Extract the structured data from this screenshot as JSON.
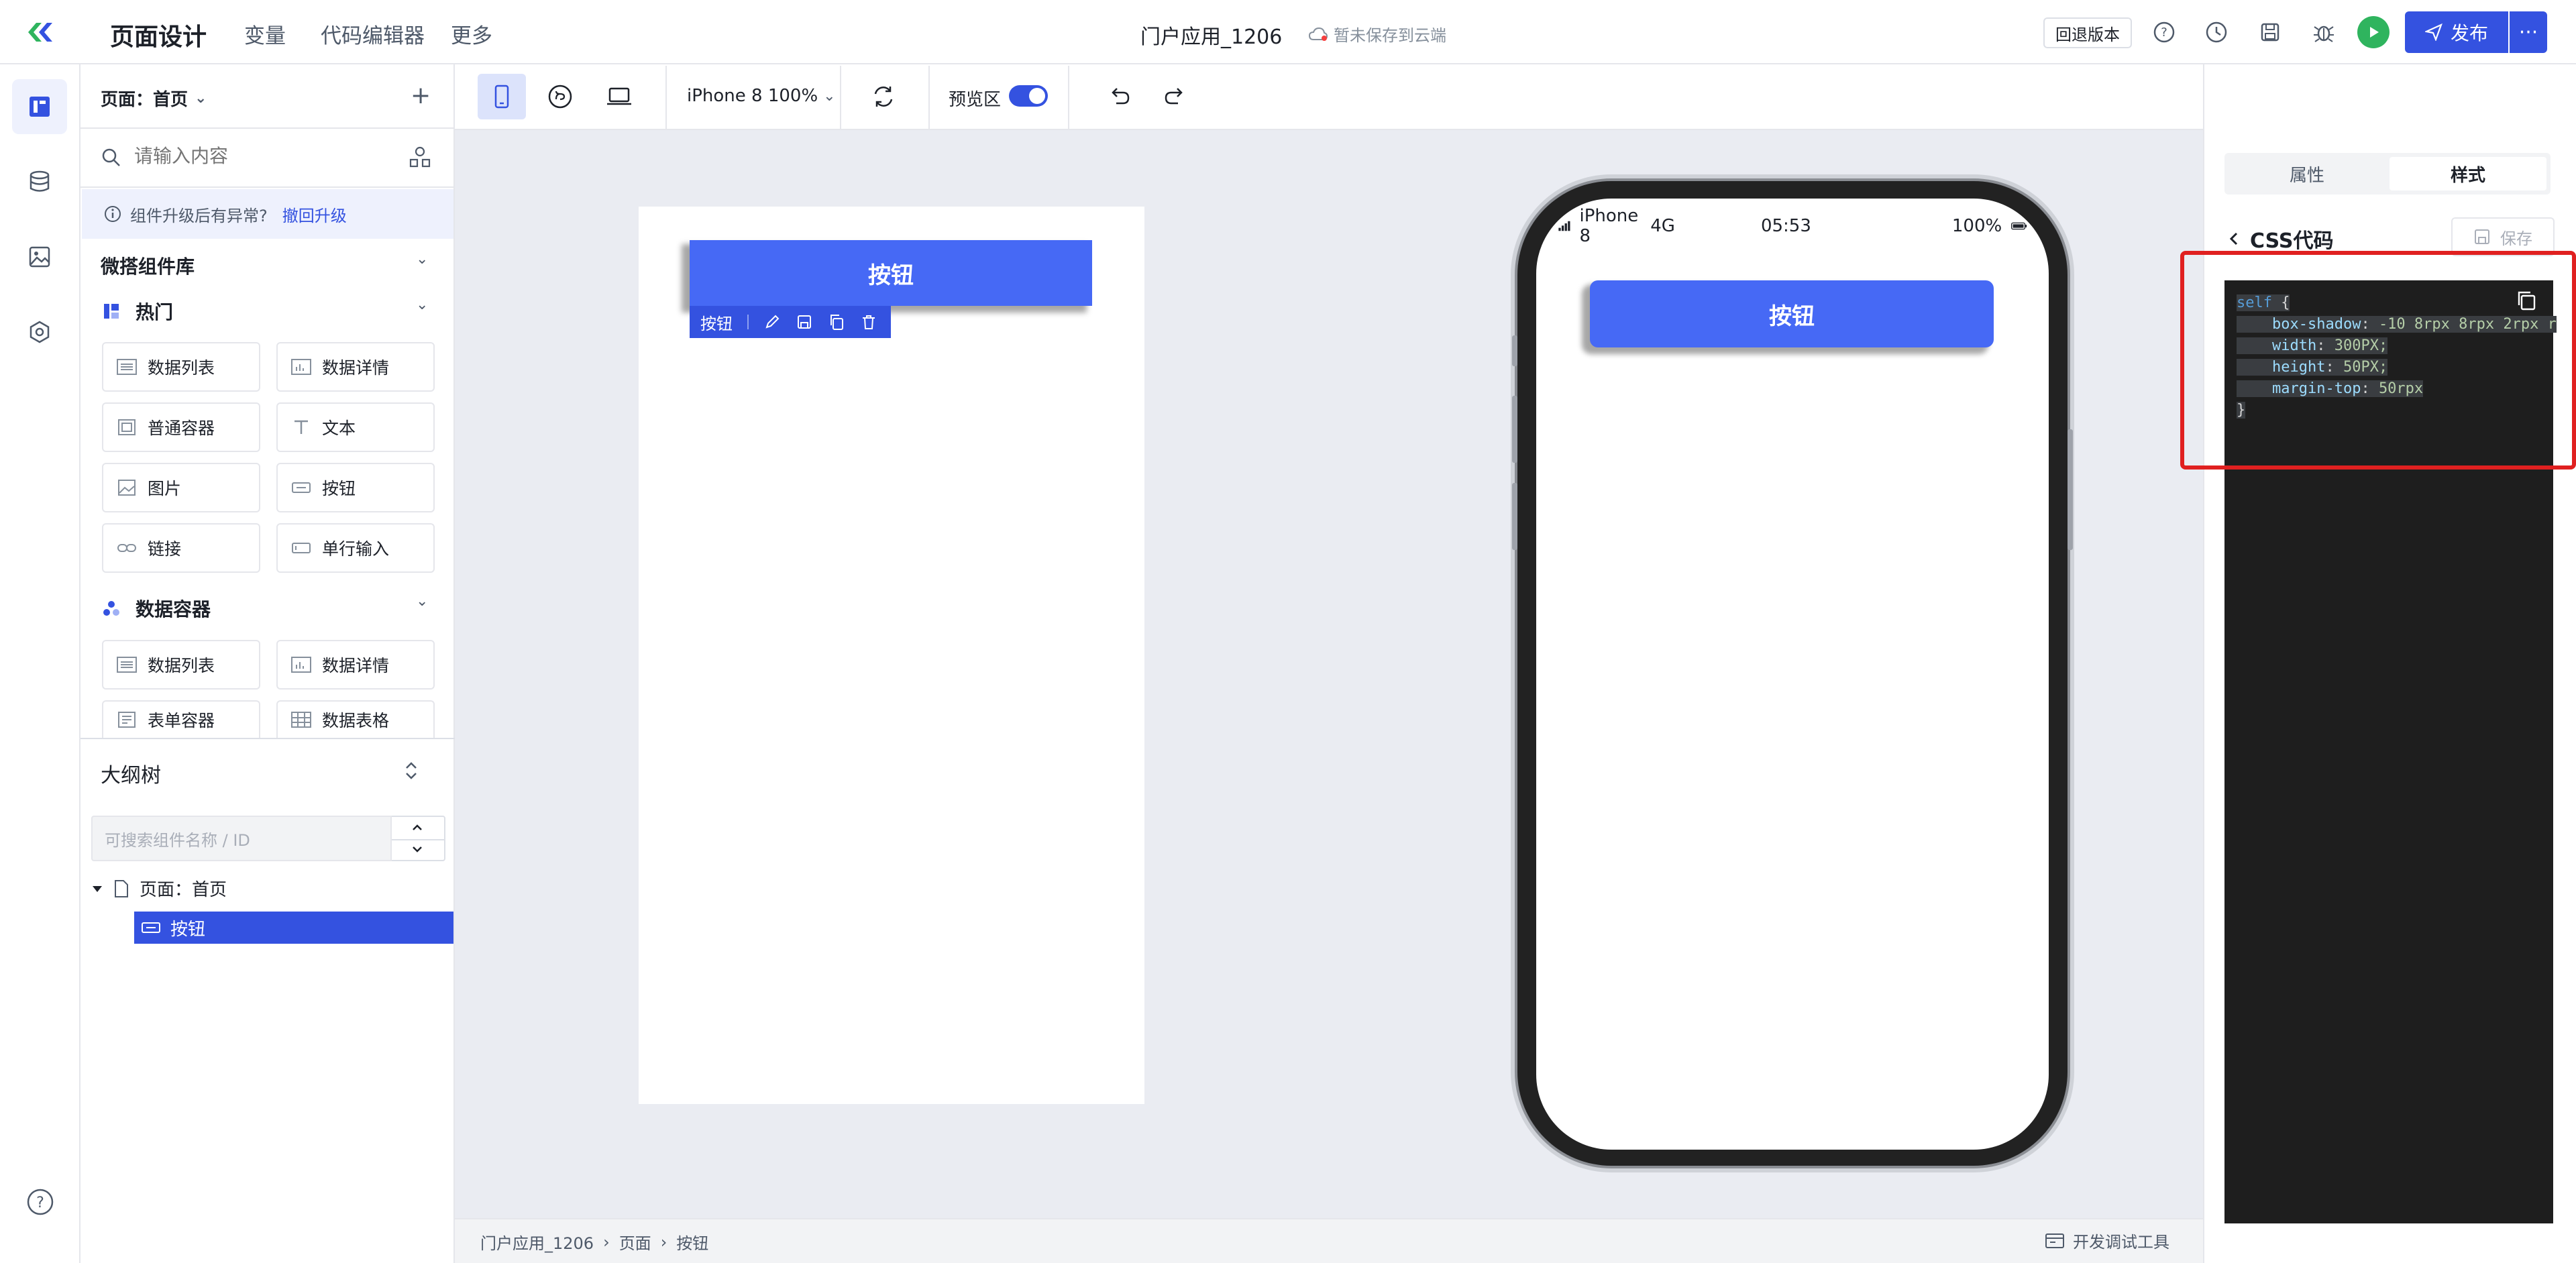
{
  "topbar": {
    "title": "页面设计",
    "nav": [
      "变量",
      "代码编辑器",
      "更多"
    ],
    "app_name": "门户应用_1206",
    "cloud_status": "暂未保存到云端",
    "revert_label": "回退版本",
    "publish_label": "发布",
    "more_label": "···"
  },
  "leftpanel": {
    "page_select": "页面：首页",
    "search_placeholder": "请输入内容",
    "notice_text": "组件升级后有异常?",
    "notice_link": "撤回升级",
    "library_title": "微搭组件库",
    "hot_title": "热门",
    "hot_items": [
      "数据列表",
      "数据详情",
      "普通容器",
      "文本",
      "图片",
      "按钮",
      "链接",
      "单行输入"
    ],
    "data_container_title": "数据容器",
    "data_items": [
      "数据列表",
      "数据详情",
      "表单容器",
      "数据表格"
    ],
    "outline_title": "大纲树",
    "outline_search_placeholder": "可搜索组件名称 / ID",
    "tree_page": "页面：首页",
    "tree_button": "按钮"
  },
  "toolbar": {
    "device": "iPhone 8 100%",
    "preview_label": "预览区"
  },
  "canvas": {
    "button_label": "按钮",
    "selection_label": "按钮"
  },
  "phone": {
    "carrier": "iPhone 8",
    "network": "4G",
    "time": "05:53",
    "battery": "100%",
    "button_label": "按钮"
  },
  "rightpanel": {
    "tab_attr": "属性",
    "tab_style": "样式",
    "css_title": "CSS代码",
    "save_label": "保存",
    "code": {
      "selector": "self",
      "open": "{",
      "lines": [
        {
          "prop": "box-shadow",
          "value": "-10 8rpx 8rpx 2rpx r"
        },
        {
          "prop": "width",
          "value": "300PX;"
        },
        {
          "prop": "height",
          "value": "50PX;"
        },
        {
          "prop": "margin-top",
          "value": "50rpx"
        }
      ],
      "close": "}"
    }
  },
  "footer": {
    "breadcrumb": [
      "门户应用_1206",
      "页面",
      "按钮"
    ],
    "devtools_label": "开发调试工具"
  },
  "colors": {
    "accent": "#3452e0",
    "button_blue": "#4669f5",
    "highlight_red": "#e02020",
    "run_green": "#2fb45e"
  }
}
